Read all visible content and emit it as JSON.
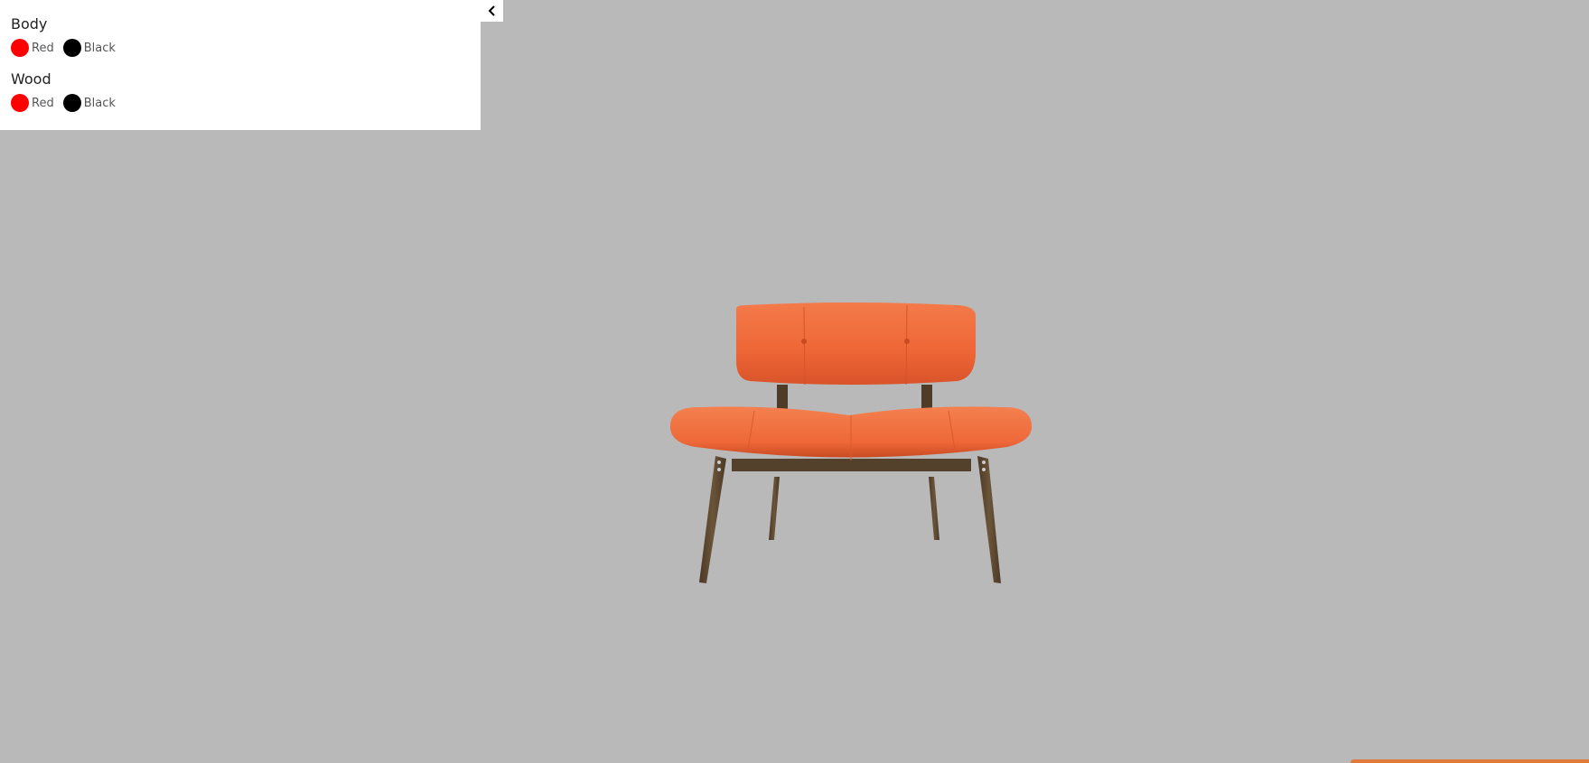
{
  "configurator": {
    "sections": [
      {
        "title": "Body",
        "options": [
          {
            "label": "Red",
            "color": "#ff0000"
          },
          {
            "label": "Black",
            "color": "#000000"
          }
        ]
      },
      {
        "title": "Wood",
        "options": [
          {
            "label": "Red",
            "color": "#ff0000"
          },
          {
            "label": "Black",
            "color": "#000000"
          }
        ]
      }
    ],
    "collapse_icon": "chevron-left-icon"
  },
  "viewer": {
    "background_color": "#b9b9b9",
    "model": "chair",
    "upholstery_color": "#f06a38",
    "wood_color": "#5a4630"
  }
}
